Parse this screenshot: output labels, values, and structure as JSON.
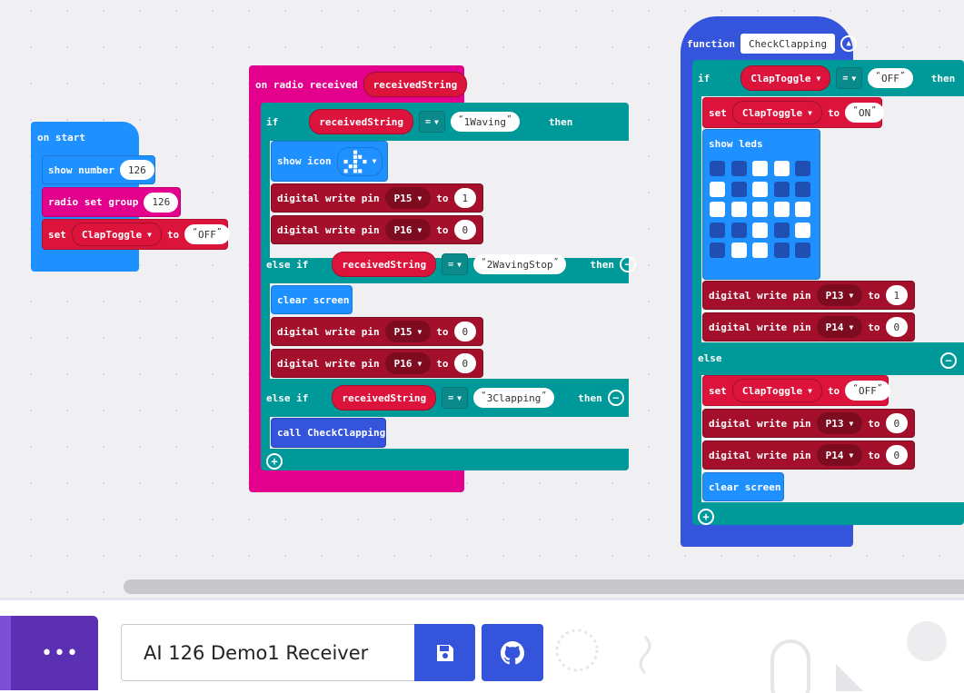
{
  "colors": {
    "basic": "#1e90ff",
    "radio": "#e3008c",
    "variables": "#dc143c",
    "pins": "#a4102b",
    "logic": "#009999",
    "functions": "#3455db",
    "led_off": "#1f4fb3",
    "toolbar_purple": "#5b2fb2"
  },
  "on_start": {
    "label": "on start",
    "show_number": {
      "label": "show number",
      "value": "126"
    },
    "radio_group": {
      "label": "radio set group",
      "value": "126"
    },
    "set": {
      "label": "set",
      "var": "ClapToggle",
      "to": "to",
      "value": "OFF"
    }
  },
  "on_radio": {
    "label": "on radio received",
    "param": "receivedString",
    "if": {
      "label": "if",
      "var": "receivedString",
      "op": "=",
      "value": "1Waving",
      "then": "then"
    },
    "show_icon": {
      "label": "show icon",
      "icon": "icon-dots"
    },
    "dw1": {
      "label": "digital write pin",
      "pin": "P15",
      "to": "to",
      "value": "1"
    },
    "dw2": {
      "label": "digital write pin",
      "pin": "P16",
      "to": "to",
      "value": "0"
    },
    "elseif1": {
      "label": "else if",
      "var": "receivedString",
      "op": "=",
      "value": "2WavingStop",
      "then": "then"
    },
    "clear": {
      "label": "clear screen"
    },
    "dw3": {
      "label": "digital write pin",
      "pin": "P15",
      "to": "to",
      "value": "0"
    },
    "dw4": {
      "label": "digital write pin",
      "pin": "P16",
      "to": "to",
      "value": "0"
    },
    "elseif2": {
      "label": "else if",
      "var": "receivedString",
      "op": "=",
      "value": "3Clapping",
      "then": "then"
    },
    "call": {
      "label": "call CheckClapping"
    }
  },
  "function": {
    "label": "function",
    "name": "CheckClapping",
    "if": {
      "label": "if",
      "var": "ClapToggle",
      "op": "=",
      "value": "OFF",
      "then": "then"
    },
    "set_on": {
      "label": "set",
      "var": "ClapToggle",
      "to": "to",
      "value": "ON"
    },
    "show_leds": {
      "label": "show leds",
      "grid": [
        [
          0,
          0,
          1,
          1,
          0
        ],
        [
          1,
          0,
          1,
          0,
          0
        ],
        [
          1,
          1,
          1,
          1,
          1
        ],
        [
          0,
          0,
          1,
          0,
          1
        ],
        [
          0,
          1,
          1,
          0,
          0
        ]
      ]
    },
    "dw1": {
      "label": "digital write pin",
      "pin": "P13",
      "to": "to",
      "value": "1"
    },
    "dw2": {
      "label": "digital write pin",
      "pin": "P14",
      "to": "to",
      "value": "0"
    },
    "else": {
      "label": "else"
    },
    "set_off": {
      "label": "set",
      "var": "ClapToggle",
      "to": "to",
      "value": "OFF"
    },
    "dw3": {
      "label": "digital write pin",
      "pin": "P13",
      "to": "to",
      "value": "0"
    },
    "dw4": {
      "label": "digital write pin",
      "pin": "P14",
      "to": "to",
      "value": "0"
    },
    "clear": {
      "label": "clear screen"
    }
  },
  "toolbar": {
    "more_label": "•••",
    "project_name": "AI 126 Demo1 Receiver",
    "save_icon": "save-icon",
    "github_icon": "github-icon"
  }
}
